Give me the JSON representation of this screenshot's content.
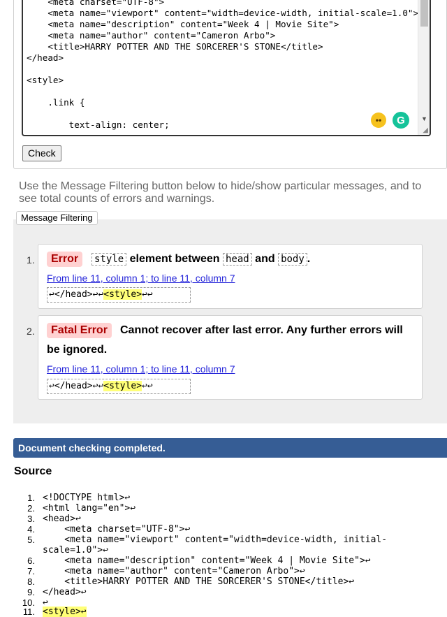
{
  "editor": {
    "lines": [
      "    <meta charset=\"UTF-8\">",
      "    <meta name=\"viewport\" content=\"width=device-width, initial-scale=1.0\">",
      "    <meta name=\"description\" content=\"Week 4 | Movie Site\">",
      "    <meta name=\"author\" content=\"Cameron Arbo\">",
      "    <title>HARRY POTTER AND THE SORCERER'S STONE</title>",
      "</head>",
      "",
      "<style>",
      "",
      "    .link {",
      "",
      "        text-align: center;"
    ],
    "emoji_glyph": "••",
    "grammarly_glyph": "G",
    "resize_glyph": "◢",
    "scroll_arrow_glyph": "▼"
  },
  "check_button": "Check",
  "filter_info": "Use the Message Filtering button below to hide/show particular messages, and to see total counts of errors and warnings.",
  "filter_button": "Message Filtering",
  "messages": [
    {
      "num": "1.",
      "type": "Error",
      "text_code_1": "style",
      "text_1": "element between",
      "text_code_2": "head",
      "text_2": "and",
      "text_code_3": "body",
      "text_3": ".",
      "location": "From line 11, column 1; to line 11, column 7",
      "extract_before": "↩</head>↩↩",
      "extract_highlight": "<style>",
      "extract_after": "↩↩"
    },
    {
      "num": "2.",
      "type": "Fatal Error",
      "text_line_1": "Cannot recover after last error. Any further errors will",
      "text_line_2": "be ignored.",
      "location": "From line 11, column 1; to line 11, column 7",
      "extract_before": "↩</head>↩↩",
      "extract_highlight": "<style>",
      "extract_after": "↩↩"
    }
  ],
  "completed": "Document checking completed.",
  "source": {
    "title": "Source",
    "lines": [
      {
        "num": "1.",
        "text": "<!DOCTYPE html>↩"
      },
      {
        "num": "2.",
        "text": "<html lang=\"en\">↩"
      },
      {
        "num": "3.",
        "text": "<head>↩"
      },
      {
        "num": "4.",
        "text": "    <meta charset=\"UTF-8\">↩"
      },
      {
        "num": "5.",
        "text": "    <meta name=\"viewport\" content=\"width=device-width, initial-"
      },
      {
        "num": "",
        "text": "scale=1.0\">↩"
      },
      {
        "num": "6.",
        "text": "    <meta name=\"description\" content=\"Week 4 | Movie Site\">↩"
      },
      {
        "num": "7.",
        "text": "    <meta name=\"author\" content=\"Cameron Arbo\">↩"
      },
      {
        "num": "8.",
        "text": "    <title>HARRY POTTER AND THE SORCERER'S STONE</title>↩"
      },
      {
        "num": "9.",
        "text": "</head>↩"
      },
      {
        "num": "10.",
        "text": "↩"
      },
      {
        "num": "11.",
        "text": "<style>↩"
      }
    ]
  }
}
